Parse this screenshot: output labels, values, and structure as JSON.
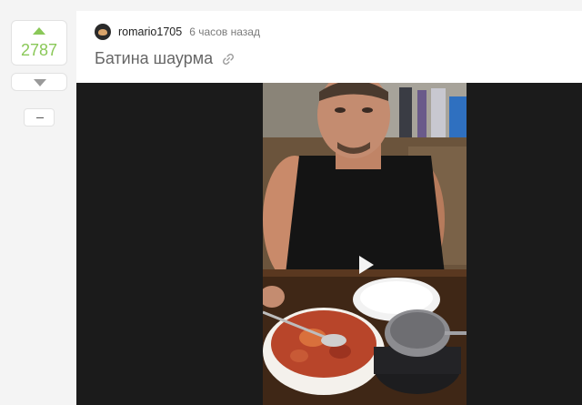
{
  "vote": {
    "count": "2787"
  },
  "story": {
    "author": "romario1705",
    "time": "6 часов назад",
    "title": "Батина шаурма"
  },
  "icons": {
    "upvote": "arrow-up-icon",
    "downvote": "arrow-down-icon",
    "collapse": "minus-icon",
    "link": "link-icon",
    "play": "play-icon"
  },
  "colors": {
    "vote_accent": "#8ac858",
    "video_bg": "#1b1b1b"
  }
}
